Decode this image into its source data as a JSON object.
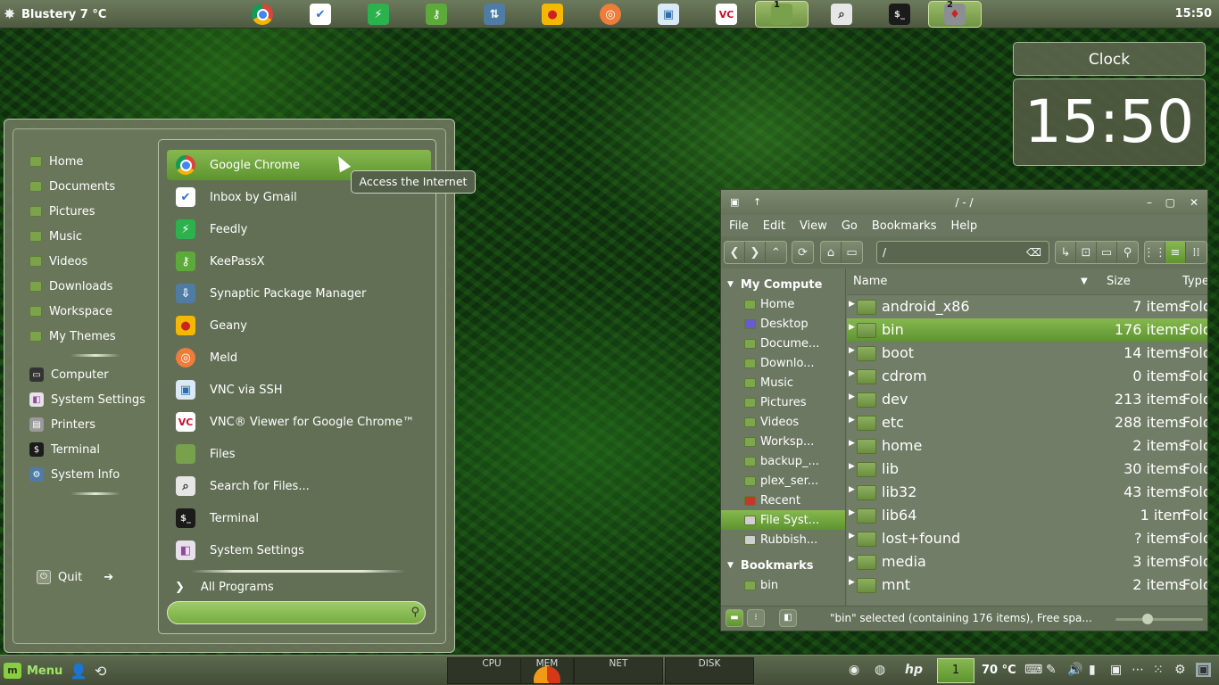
{
  "top_panel": {
    "weather": "Blustery 7 °C",
    "clock": "15:50",
    "launchers": [
      {
        "name": "chrome-icon",
        "glyph": ""
      },
      {
        "name": "gmail-icon",
        "glyph": "✔"
      },
      {
        "name": "feedly-icon",
        "glyph": "⚡"
      },
      {
        "name": "keepassx-icon",
        "glyph": "⚷"
      },
      {
        "name": "synaptic-icon",
        "glyph": "⇅"
      },
      {
        "name": "geany-icon",
        "glyph": "●"
      },
      {
        "name": "meld-icon",
        "glyph": "◎"
      },
      {
        "name": "vnc-ssh-icon",
        "glyph": "▣"
      },
      {
        "name": "vnc-viewer-icon",
        "glyph": "VC"
      },
      {
        "name": "files-icon",
        "glyph": "",
        "badge": "1"
      },
      {
        "name": "search-files-icon",
        "glyph": "⌕"
      },
      {
        "name": "terminal-icon",
        "glyph": "$_"
      },
      {
        "name": "suit-icon",
        "glyph": "♦",
        "badge": "2"
      }
    ]
  },
  "clock_widget": {
    "title": "Clock",
    "time": "15:50"
  },
  "start_menu": {
    "places": [
      {
        "label": "Home"
      },
      {
        "label": "Documents"
      },
      {
        "label": "Pictures"
      },
      {
        "label": "Music"
      },
      {
        "label": "Videos"
      },
      {
        "label": "Downloads"
      },
      {
        "label": "Workspace"
      },
      {
        "label": "My Themes"
      }
    ],
    "system": [
      {
        "label": "Computer",
        "icon": "computer-icon",
        "glyph": "▭",
        "color": "#333333"
      },
      {
        "label": "System Settings",
        "icon": "settings-icon",
        "glyph": "◧",
        "color": "#e8e0ea"
      },
      {
        "label": "Printers",
        "icon": "printer-icon",
        "glyph": "▤",
        "color": "#9a9a9a"
      },
      {
        "label": "Terminal",
        "icon": "terminal-icon",
        "glyph": "$",
        "color": "#1b1b1b"
      },
      {
        "label": "System Info",
        "icon": "gear-icon",
        "glyph": "⚙",
        "color": "#4f7ca4"
      }
    ],
    "quit": "Quit",
    "apps": [
      {
        "label": "Google Chrome",
        "icon": "chrome-icon",
        "cls": "ic-chrome",
        "glyph": ""
      },
      {
        "label": "Inbox by Gmail",
        "icon": "gmail-icon",
        "cls": "ic-gmail",
        "glyph": "✔"
      },
      {
        "label": "Feedly",
        "icon": "feedly-icon",
        "cls": "ic-feedly",
        "glyph": "⚡"
      },
      {
        "label": "KeePassX",
        "icon": "keepassx-icon",
        "cls": "ic-keepass",
        "glyph": "⚷"
      },
      {
        "label": "Synaptic Package Manager",
        "icon": "synaptic-icon",
        "cls": "ic-synaptic",
        "glyph": "⇩"
      },
      {
        "label": "Geany",
        "icon": "geany-icon",
        "cls": "ic-geany",
        "glyph": "●"
      },
      {
        "label": "Meld",
        "icon": "meld-icon",
        "cls": "ic-meld",
        "glyph": "◎"
      },
      {
        "label": "VNC via SSH",
        "icon": "vnc-ssh-icon",
        "cls": "ic-vncssh",
        "glyph": "▣"
      },
      {
        "label": "VNC® Viewer for Google Chrome™",
        "icon": "vnc-viewer-icon",
        "cls": "ic-vncviewer",
        "glyph": "VC"
      },
      {
        "label": "Files",
        "icon": "files-icon",
        "cls": "ic-files",
        "glyph": ""
      },
      {
        "label": "Search for Files...",
        "icon": "search-files-icon",
        "cls": "ic-search",
        "glyph": "⌕"
      },
      {
        "label": "Terminal",
        "icon": "terminal-icon",
        "cls": "ic-terminal",
        "glyph": "$_"
      },
      {
        "label": "System Settings",
        "icon": "settings-icon",
        "cls": "ic-settings",
        "glyph": "◧"
      }
    ],
    "all_programs": "All Programs",
    "search_value": "",
    "tooltip": "Access the Internet"
  },
  "file_manager": {
    "title": "/ - /",
    "menu": [
      "File",
      "Edit",
      "View",
      "Go",
      "Bookmarks",
      "Help"
    ],
    "path": "/",
    "sidebar_head": "My Compute",
    "sidebar_items": [
      {
        "label": "Home"
      },
      {
        "label": "Desktop"
      },
      {
        "label": "Docume..."
      },
      {
        "label": "Downlo..."
      },
      {
        "label": "Music"
      },
      {
        "label": "Pictures"
      },
      {
        "label": "Videos"
      },
      {
        "label": "Worksp..."
      },
      {
        "label": "backup_..."
      },
      {
        "label": "plex_ser..."
      },
      {
        "label": "Recent"
      },
      {
        "label": "File Syst..."
      },
      {
        "label": "Rubbish..."
      }
    ],
    "bookmarks_head": "Bookmarks",
    "bookmarks": [
      {
        "label": "bin"
      }
    ],
    "columns": {
      "name": "Name",
      "size": "Size",
      "type": "Type"
    },
    "rows": [
      {
        "name": "android_x86",
        "size": "7 items",
        "type": "Fold"
      },
      {
        "name": "bin",
        "size": "176 items",
        "type": "Fold"
      },
      {
        "name": "boot",
        "size": "14 items",
        "type": "Fold"
      },
      {
        "name": "cdrom",
        "size": "0 items",
        "type": "Fold"
      },
      {
        "name": "dev",
        "size": "213 items",
        "type": "Fold"
      },
      {
        "name": "etc",
        "size": "288 items",
        "type": "Fold"
      },
      {
        "name": "home",
        "size": "2 items",
        "type": "Fold"
      },
      {
        "name": "lib",
        "size": "30 items",
        "type": "Fold"
      },
      {
        "name": "lib32",
        "size": "43 items",
        "type": "Fold"
      },
      {
        "name": "lib64",
        "size": "1 item",
        "type": "Fold"
      },
      {
        "name": "lost+found",
        "size": "? items",
        "type": "Fold"
      },
      {
        "name": "media",
        "size": "3 items",
        "type": "Fold"
      },
      {
        "name": "mnt",
        "size": "2 items",
        "type": "Fold"
      }
    ],
    "status": "\"bin\" selected (containing 176 items), Free spa..."
  },
  "bottom_panel": {
    "menu_label": "Menu",
    "graphs": [
      "CPU",
      "MEM",
      "NET",
      "DISK"
    ],
    "workspace": "1",
    "temperature": "70 °C"
  }
}
